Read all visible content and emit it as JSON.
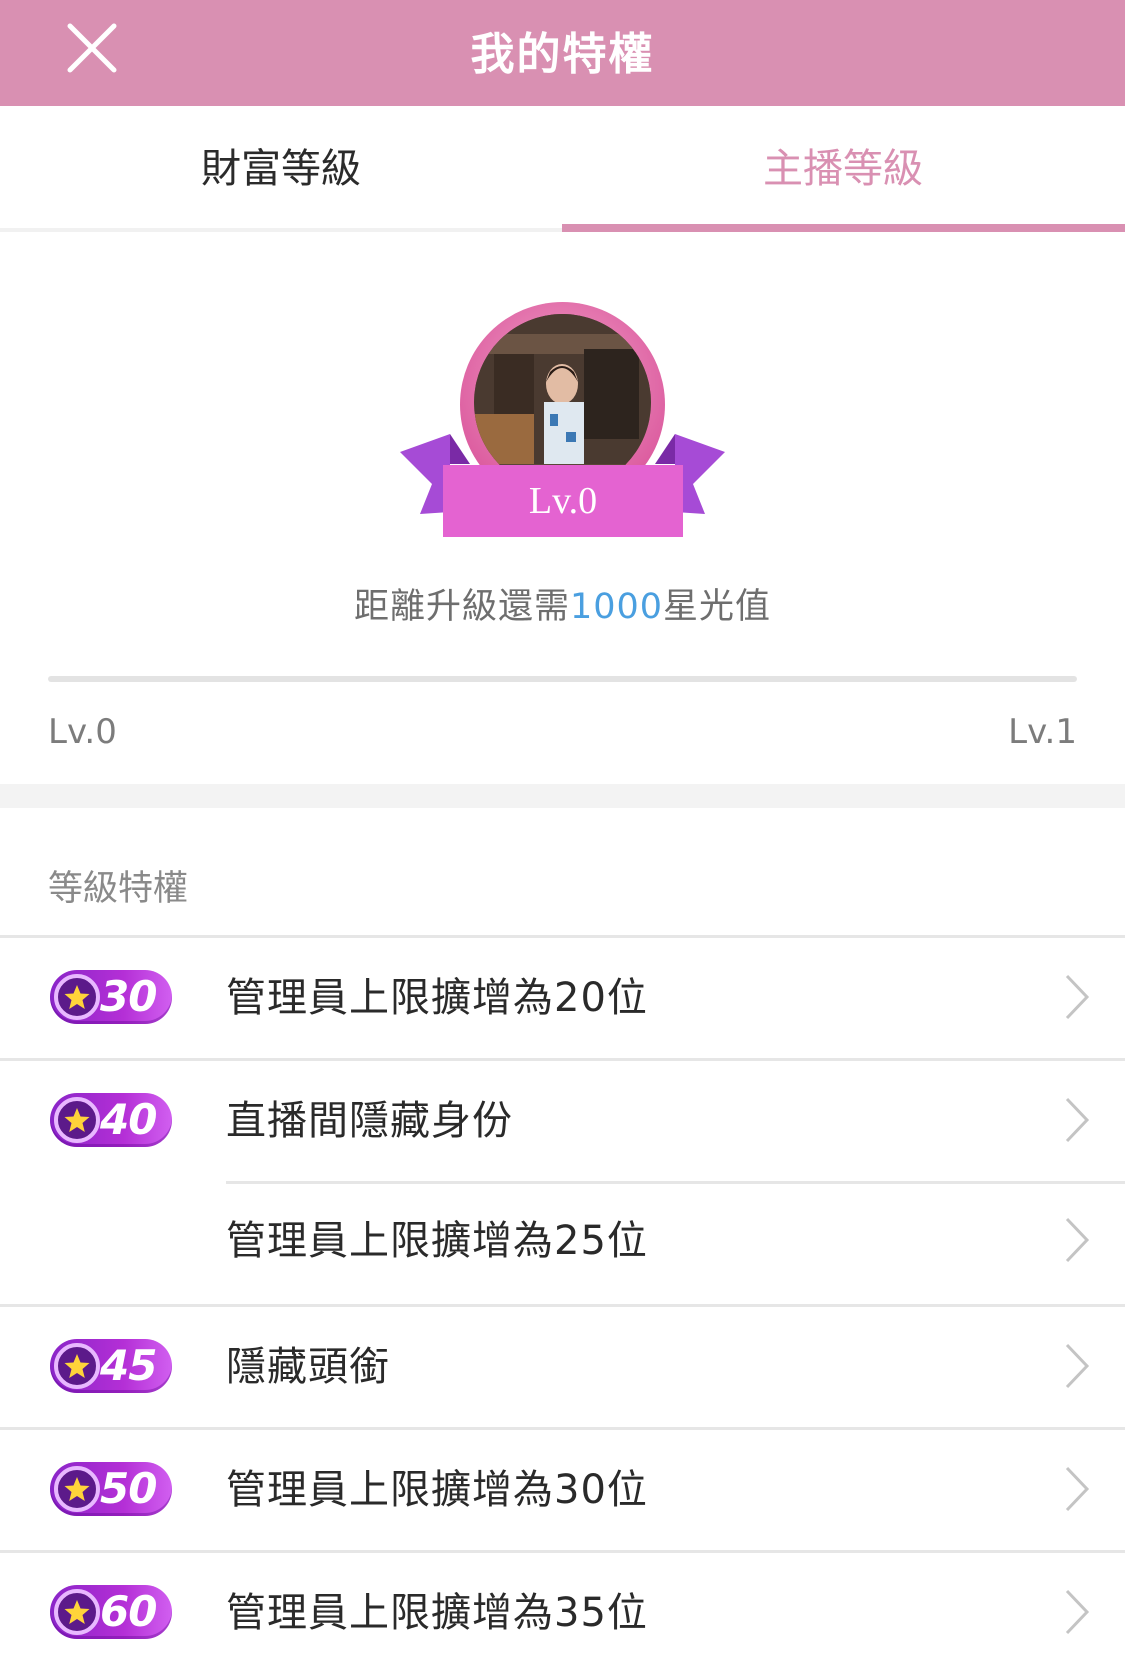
{
  "header": {
    "title": "我的特權"
  },
  "tabs": [
    {
      "label": "財富等級",
      "active": false
    },
    {
      "label": "主播等級",
      "active": true
    }
  ],
  "level": {
    "badge_label": "Lv.0",
    "distance_prefix": "距離升級還需",
    "distance_value": "1000",
    "distance_suffix": "星光值",
    "progress": 0,
    "start_label": "Lv.0",
    "end_label": "Lv.1"
  },
  "privileges": {
    "title": "等級特權",
    "rows": [
      {
        "level": "30",
        "text": "管理員上限擴增為20位",
        "show_badge": true
      },
      {
        "level": "40",
        "text": "直播間隱藏身份",
        "show_badge": true
      },
      {
        "level": "",
        "text": "管理員上限擴增為25位",
        "show_badge": false
      },
      {
        "level": "45",
        "text": "隱藏頭銜",
        "show_badge": true
      },
      {
        "level": "50",
        "text": "管理員上限擴增為30位",
        "show_badge": true
      },
      {
        "level": "60",
        "text": "管理員上限擴增為35位",
        "show_badge": true
      }
    ]
  },
  "colors": {
    "brand": "#d990b2",
    "ribbon": "#e463d1",
    "highlight": "#4a9fe0",
    "badge": "#8a25c8"
  },
  "icons": {
    "close": "close-icon",
    "chevron": "chevron-right-icon",
    "star": "star-icon"
  }
}
